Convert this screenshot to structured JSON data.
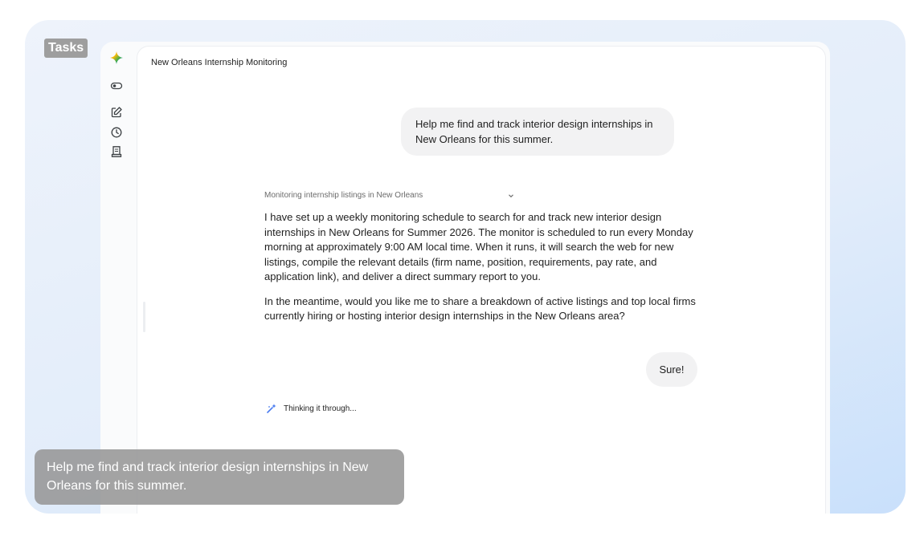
{
  "overlay": {
    "tasks_tag": "Tasks",
    "caption": "Help me find and track interior design internships in New Orleans for this summer."
  },
  "sidebar": {
    "icons": [
      "gemini-logo",
      "toggle-icon",
      "new-chat-icon",
      "history-icon",
      "notes-icon"
    ]
  },
  "conversation": {
    "title": "New Orleans Internship Monitoring",
    "user_message_1": "Help me find and track interior design internships in New Orleans for this summer.",
    "status_label": "Monitoring internship listings in New Orleans",
    "response_paragraphs": [
      "I have set up a weekly monitoring schedule to search for and track new interior design internships in New Orleans for Summer 2026. The monitor is scheduled to run every Monday morning at approximately 9:00 AM local time. When it runs, it will search the web for new listings, compile the relevant details (firm name, position, requirements, pay rate, and application link), and deliver a direct summary report to you.",
      "In the meantime, would you like me to share a breakdown of active listings and top local firms currently hiring or hosting interior design internships in the New Orleans area?"
    ],
    "user_message_2": "Sure!",
    "thinking_label": "Thinking it through..."
  },
  "colors": {
    "gemini_blue": "#4a7cf0",
    "gemini_red": "#ea4335",
    "gemini_yellow": "#fbbc04",
    "gemini_green": "#34a853"
  }
}
